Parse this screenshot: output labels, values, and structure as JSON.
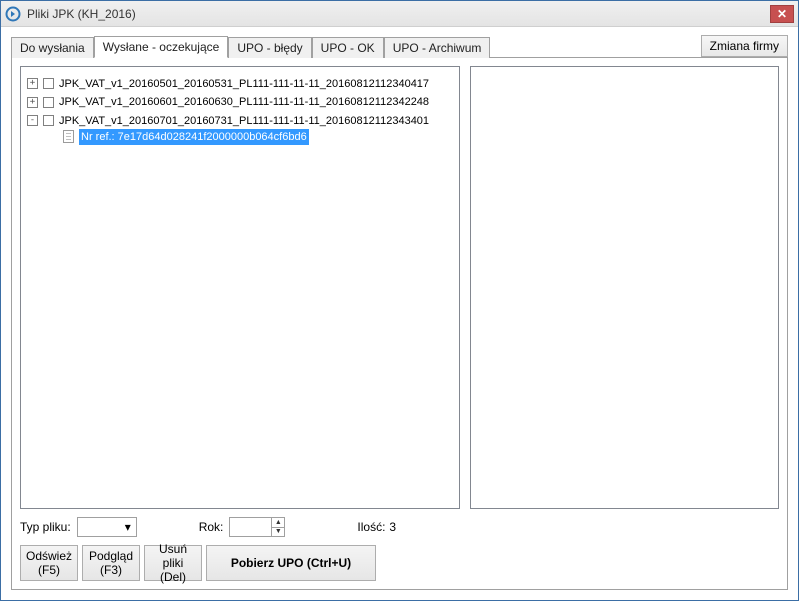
{
  "window": {
    "title": "Pliki JPK (KH_2016)"
  },
  "topbutton": {
    "change_company": "Zmiana firmy"
  },
  "tabs": {
    "items": [
      {
        "label": "Do wysłania"
      },
      {
        "label": "Wysłane - oczekujące"
      },
      {
        "label": "UPO - błędy"
      },
      {
        "label": "UPO - OK"
      },
      {
        "label": "UPO - Archiwum"
      }
    ],
    "active_index": 1
  },
  "tree": {
    "nodes": [
      {
        "expand": "+",
        "label": "JPK_VAT_v1_20160501_20160531_PL111-111-11-11_20160812112340417"
      },
      {
        "expand": "+",
        "label": "JPK_VAT_v1_20160601_20160630_PL111-111-11-11_20160812112342248"
      },
      {
        "expand": "-",
        "label": "JPK_VAT_v1_20160701_20160731_PL111-111-11-11_20160812112343401",
        "children": [
          {
            "selected": true,
            "label": "Nr ref.: 7e17d64d028241f2000000b064cf6bd6"
          }
        ]
      }
    ]
  },
  "filters": {
    "type_label": "Typ pliku:",
    "year_label": "Rok:",
    "count_label": "Ilość:",
    "count_value": "3"
  },
  "buttons": {
    "refresh_line1": "Odśwież",
    "refresh_line2": "(F5)",
    "preview_line1": "Podgląd",
    "preview_line2": "(F3)",
    "delete_line1": "Usuń pliki",
    "delete_line2": "(Del)",
    "download": "Pobierz UPO (Ctrl+U)"
  }
}
